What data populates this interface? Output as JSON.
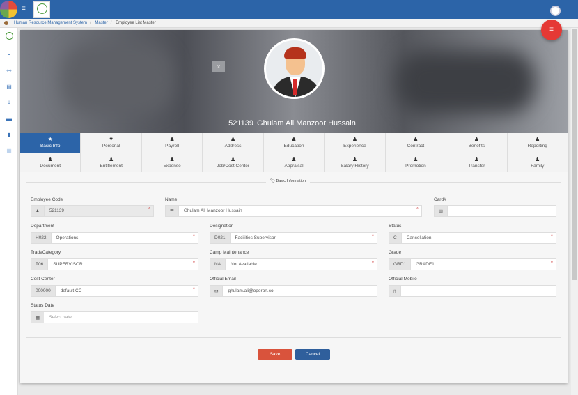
{
  "header": {
    "menu_icon": "hamburger-icon",
    "user_icon": "user-circle-icon"
  },
  "breadcrumb": [
    "Human Resource Management System",
    "Master",
    "Employee List Master"
  ],
  "sidebar": {
    "icons": [
      "dashboard-icon",
      "share-icon",
      "document-icon",
      "download-icon",
      "card-icon",
      "file-icon",
      "grid-icon"
    ]
  },
  "profile": {
    "code": "521139",
    "name": "Ghulam Ali Manzoor Hussain",
    "close_label": "×"
  },
  "tabs": [
    {
      "label": "Basic Info",
      "icon": "star-icon",
      "active": true
    },
    {
      "label": "Personal",
      "icon": "heart-icon"
    },
    {
      "label": "Payroll",
      "icon": "user-icon"
    },
    {
      "label": "Address",
      "icon": "user-icon"
    },
    {
      "label": "Education",
      "icon": "user-icon"
    },
    {
      "label": "Experience",
      "icon": "user-icon"
    },
    {
      "label": "Contract",
      "icon": "user-icon"
    },
    {
      "label": "Benefits",
      "icon": "user-icon"
    },
    {
      "label": "Reporting",
      "icon": "user-icon"
    },
    {
      "label": "Document",
      "icon": "user-icon"
    },
    {
      "label": "Entitlement",
      "icon": "user-icon"
    },
    {
      "label": "Expense",
      "icon": "user-icon"
    },
    {
      "label": "Job/Cost Center",
      "icon": "user-icon"
    },
    {
      "label": "Appraisal",
      "icon": "user-icon"
    },
    {
      "label": "Salary History",
      "icon": "user-icon"
    },
    {
      "label": "Promotion",
      "icon": "user-icon"
    },
    {
      "label": "Transfer",
      "icon": "user-icon"
    },
    {
      "label": "Family",
      "icon": "user-icon"
    }
  ],
  "section_title": "Basic Information",
  "fields": {
    "employee_code": {
      "label": "Employee Code",
      "value": "521139"
    },
    "name": {
      "label": "Name",
      "value": "Ghulam Ali Manzoor Hussain"
    },
    "card": {
      "label": "Card#",
      "value": ""
    },
    "department": {
      "label": "Department",
      "code": "H022",
      "value": "Operations"
    },
    "designation": {
      "label": "Designation",
      "code": "D021",
      "value": "Facilities Supervisor"
    },
    "status": {
      "label": "Status",
      "code": "C",
      "value": "Cancellation"
    },
    "trade_category": {
      "label": "TradeCategory",
      "code": "T06",
      "value": "SUPERVISOR"
    },
    "camp_maintenance": {
      "label": "Camp Maintenance",
      "code": "NA",
      "value": "Not Available"
    },
    "grade": {
      "label": "Grade",
      "code": "GRD1",
      "value": "GRADE1"
    },
    "cost_center": {
      "label": "Cost Center",
      "code": "000000",
      "value": "default CC"
    },
    "official_email": {
      "label": "Official Email",
      "value": "ghulam.ali@operon.co"
    },
    "official_mobile": {
      "label": "Official Mobile",
      "value": ""
    },
    "status_date": {
      "label": "Status Date",
      "placeholder": "Select date"
    }
  },
  "required_mark": "*",
  "buttons": {
    "save": "Save",
    "cancel": "Cancel",
    "fab_icon": "menu-icon"
  },
  "colors": {
    "primary": "#2c64a8",
    "save": "#d9533c",
    "fab": "#e53935"
  }
}
